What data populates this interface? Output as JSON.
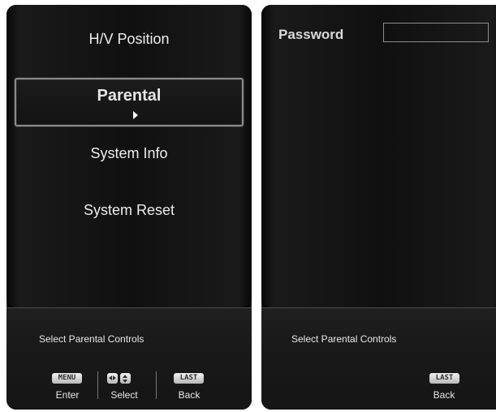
{
  "left_panel": {
    "menu_items": {
      "hv_position": "H/V Position",
      "parental": "Parental",
      "system_info": "System Info",
      "system_reset": "System Reset"
    },
    "status": "Select Parental Controls",
    "keys": {
      "menu_key": "MENU",
      "last_key": "LAST",
      "enter_label": "Enter",
      "select_label": "Select",
      "back_label": "Back"
    }
  },
  "right_panel": {
    "password_label": "Password",
    "password_value": "",
    "status": "Select Parental Controls",
    "keys": {
      "last_key": "LAST",
      "back_label": "Back"
    }
  },
  "icons": {
    "selection_arrow": "right-triangle-icon",
    "left_right_key": "left-right-arrow-icon",
    "up_down_key": "up-down-arrow-icon"
  },
  "colors": {
    "background": "#151515",
    "text": "#ececec",
    "selection_border": "#8a8a8a"
  }
}
